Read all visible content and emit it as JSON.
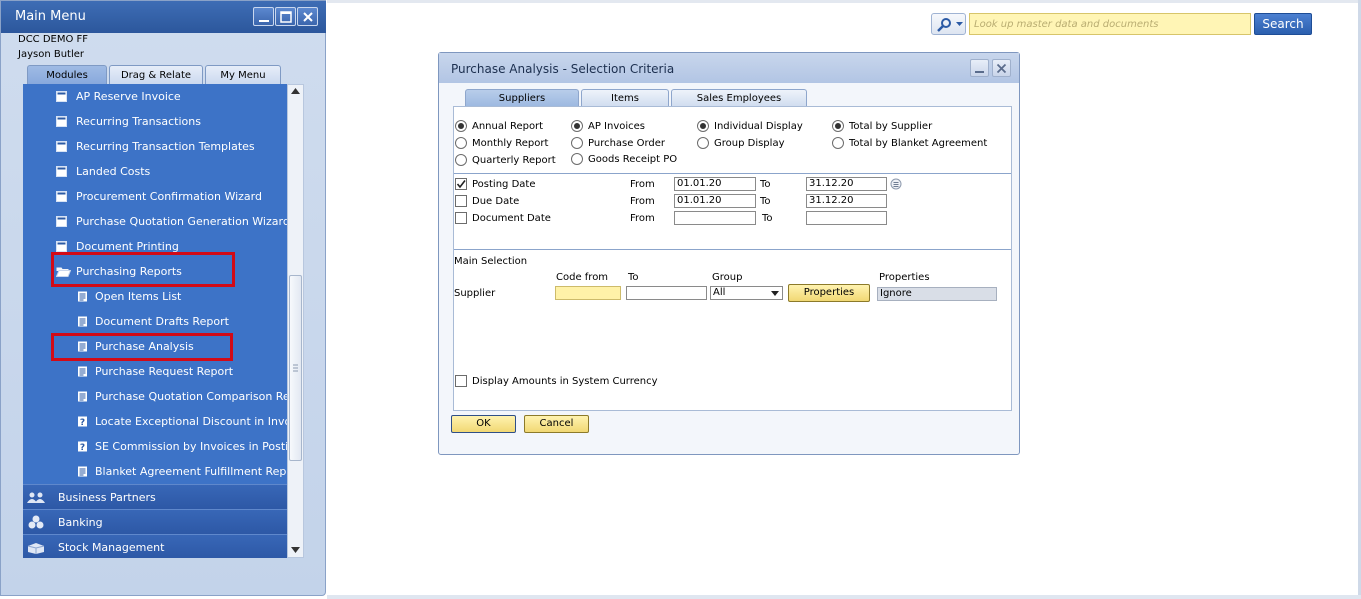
{
  "main_menu": {
    "title": "Main Menu",
    "company": "DCC DEMO FF",
    "user": "Jayson Butler",
    "tabs": [
      "Modules",
      "Drag & Relate",
      "My Menu"
    ],
    "items": [
      {
        "label": "AP Reserve Invoice",
        "icon": "form-icon"
      },
      {
        "label": "Recurring Transactions",
        "icon": "form-icon"
      },
      {
        "label": "Recurring Transaction Templates",
        "icon": "form-icon"
      },
      {
        "label": "Landed Costs",
        "icon": "form-icon"
      },
      {
        "label": "Procurement Confirmation Wizard",
        "icon": "form-icon"
      },
      {
        "label": "Purchase Quotation Generation Wizard",
        "icon": "form-icon"
      },
      {
        "label": "Document Printing",
        "icon": "form-icon"
      },
      {
        "label": "Purchasing Reports",
        "icon": "folder-open-icon"
      },
      {
        "label": "Open Items List",
        "icon": "report-icon"
      },
      {
        "label": "Document Drafts Report",
        "icon": "report-icon"
      },
      {
        "label": "Purchase Analysis",
        "icon": "report-icon"
      },
      {
        "label": "Purchase Request Report",
        "icon": "report-icon"
      },
      {
        "label": "Purchase Quotation Comparison Repo",
        "icon": "report-icon"
      },
      {
        "label": "Locate Exceptional Discount in Invoice",
        "icon": "query-icon"
      },
      {
        "label": "SE Commission by Invoices in Posting",
        "icon": "query-icon"
      },
      {
        "label": "Blanket Agreement Fulfillment Report",
        "icon": "report-icon"
      }
    ],
    "modules": [
      {
        "label": "Business Partners",
        "icon": "business-partners-icon"
      },
      {
        "label": "Banking",
        "icon": "banking-icon"
      },
      {
        "label": "Stock Management",
        "icon": "stock-management-icon"
      }
    ]
  },
  "search": {
    "placeholder": "Look up master data and documents",
    "button_label": "Search"
  },
  "dialog": {
    "title": "Purchase Analysis - Selection Criteria",
    "tabs": [
      "Suppliers",
      "Items",
      "Sales Employees"
    ],
    "period_options": [
      {
        "label": "Annual Report",
        "selected": true
      },
      {
        "label": "Monthly Report",
        "selected": false
      },
      {
        "label": "Quarterly Report",
        "selected": false
      }
    ],
    "document_options": [
      {
        "label": "AP Invoices",
        "selected": true
      },
      {
        "label": "Purchase Order",
        "selected": false
      },
      {
        "label": "Goods Receipt PO",
        "selected": false
      }
    ],
    "display_options": [
      {
        "label": "Individual Display",
        "selected": true
      },
      {
        "label": "Group Display",
        "selected": false
      }
    ],
    "total_options": [
      {
        "label": "Total by Supplier",
        "selected": true
      },
      {
        "label": "Total by Blanket Agreement",
        "selected": false
      }
    ],
    "dates": [
      {
        "label": "Posting Date",
        "checked": true,
        "from_label": "From",
        "from": "01.01.20",
        "to_label": "To",
        "to": "31.12.20"
      },
      {
        "label": "Due Date",
        "checked": false,
        "from_label": "From",
        "from": "01.01.20",
        "to_label": "To",
        "to": "31.12.20"
      },
      {
        "label": "Document Date",
        "checked": false,
        "from_label": "From",
        "from": "",
        "to_label": "To",
        "to": ""
      }
    ],
    "main_selection": {
      "heading": "Main Selection",
      "col_code_from": "Code from",
      "col_to": "To",
      "col_group": "Group",
      "col_properties": "Properties",
      "row_label": "Supplier",
      "code_from": "",
      "code_to": "",
      "group_value": "All",
      "properties_button": "Properties",
      "properties_value": "Ignore"
    },
    "system_currency_label": "Display Amounts in System Currency",
    "ok_label": "OK",
    "cancel_label": "Cancel"
  }
}
